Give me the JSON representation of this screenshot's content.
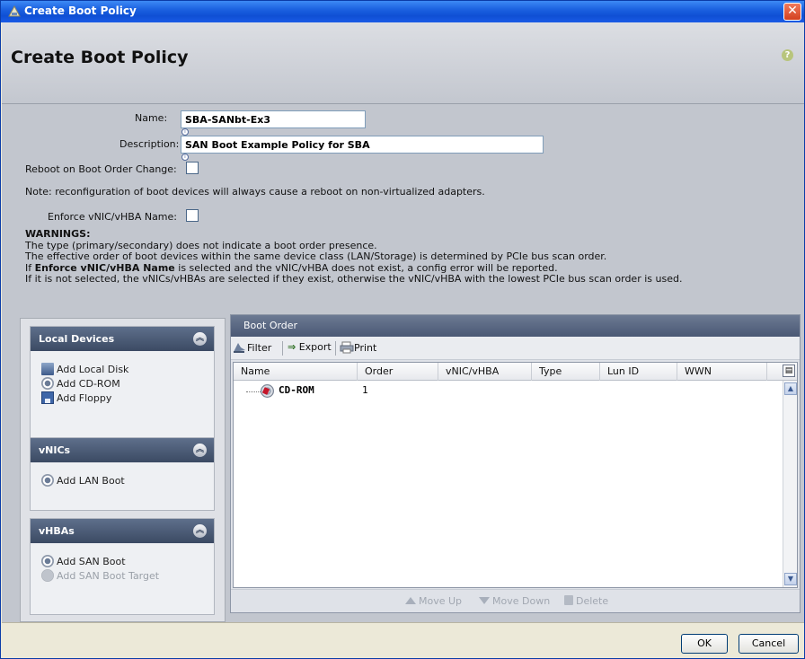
{
  "window": {
    "title": "Create Boot Policy",
    "close_glyph": "✕"
  },
  "header": {
    "title": "Create Boot Policy",
    "help_glyph": "?"
  },
  "form": {
    "name_label": "Name:",
    "name_value": "SBA-SANbt-Ex3",
    "description_label": "Description:",
    "description_value": "SAN Boot Example Policy for SBA",
    "reboot_label": "Reboot on Boot Order Change:",
    "reboot_checked": false,
    "note": "Note: reconfiguration of boot devices will always cause a reboot on non-virtualized adapters.",
    "enforce_label": "Enforce vNIC/vHBA Name:",
    "enforce_checked": false
  },
  "warnings": {
    "title": "WARNINGS:",
    "line1": "The type (primary/secondary) does not indicate a boot order presence.",
    "line2": "The effective order of boot devices within the same device class (LAN/Storage) is determined by PCIe bus scan order.",
    "line3_prefix": "If ",
    "line3_bold": "Enforce vNIC/vHBA Name",
    "line3_suffix": " is selected and the vNIC/vHBA does not exist, a config error will be reported.",
    "line4": "If it is not selected, the vNICs/vHBAs are selected if they exist, otherwise the vNIC/vHBA with the lowest PCIe bus scan order is used."
  },
  "sections": {
    "local": {
      "title": "Local Devices",
      "items": [
        "Add Local Disk",
        "Add CD-ROM",
        "Add Floppy"
      ]
    },
    "vnics": {
      "title": "vNICs",
      "items": [
        "Add LAN Boot"
      ]
    },
    "vhbas": {
      "title": "vHBAs",
      "items": [
        "Add SAN Boot",
        "Add SAN Boot Target"
      ]
    }
  },
  "boot_order": {
    "title": "Boot Order",
    "toolbar": {
      "filter": "Filter",
      "export": "Export",
      "print": "Print"
    },
    "columns": [
      "Name",
      "Order",
      "vNIC/vHBA",
      "Type",
      "Lun ID",
      "WWN"
    ],
    "rows": [
      {
        "name": "CD-ROM",
        "order": "1",
        "vnic": "",
        "type": "",
        "lun": "",
        "wwn": ""
      }
    ],
    "footer": {
      "move_up": "Move Up",
      "move_down": "Move Down",
      "delete": "Delete"
    }
  },
  "dialog_buttons": {
    "ok": "OK",
    "cancel": "Cancel"
  },
  "colors": {
    "titlebar": "#1b61e0",
    "section_header": "#3b4a63",
    "panel_bg": "#c2c6ce"
  }
}
